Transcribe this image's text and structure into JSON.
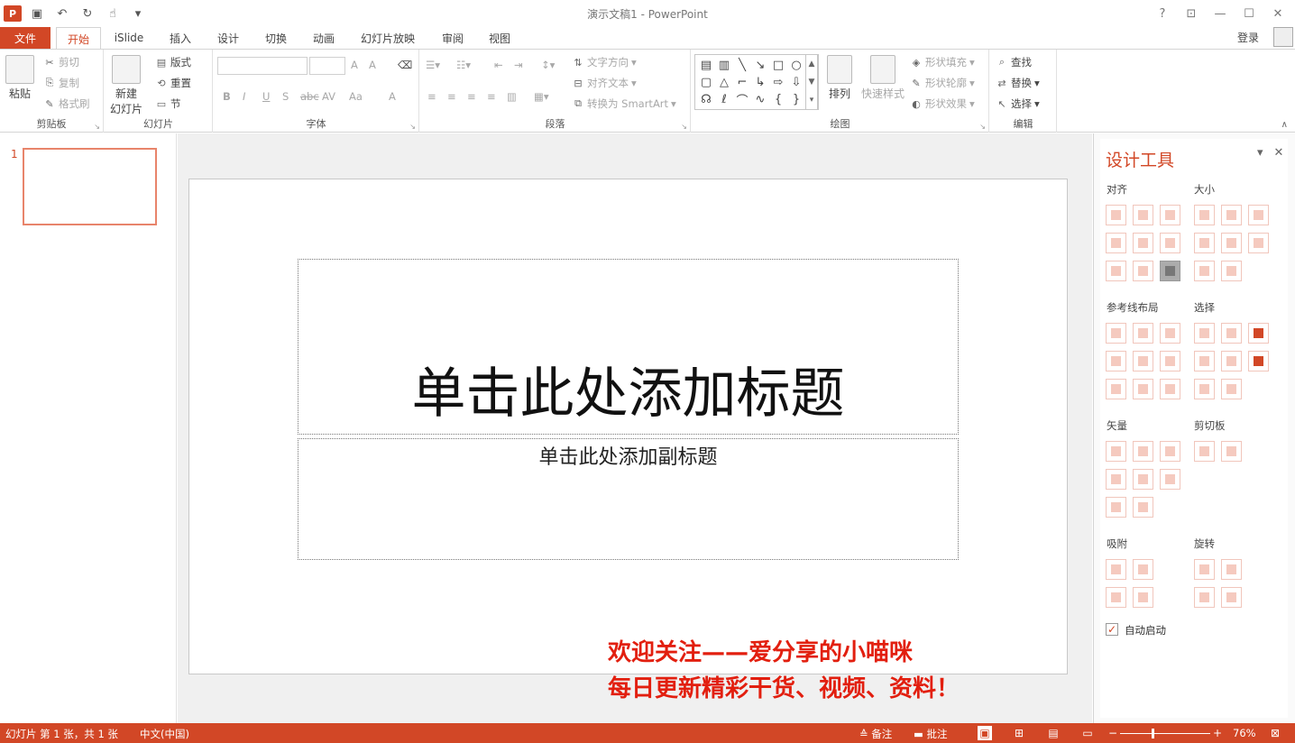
{
  "app": {
    "window_title": "演示文稿1 - PowerPoint",
    "login_label": "登录",
    "accent_color": "#d24726",
    "icon_text": "P"
  },
  "qat": {
    "icons": [
      "save-icon",
      "undo-icon",
      "redo-icon",
      "touch-mode-icon",
      "customize-qat-icon"
    ]
  },
  "window_controls": [
    "?",
    "restore-ribbon-icon",
    "minimize-icon",
    "maximize-icon",
    "close-icon"
  ],
  "tabs": {
    "file": "文件",
    "items": [
      "开始",
      "iSlide",
      "插入",
      "设计",
      "切换",
      "动画",
      "幻灯片放映",
      "审阅",
      "视图"
    ],
    "active": "开始"
  },
  "ribbon": {
    "clipboard": {
      "label": "剪贴板",
      "paste": "粘贴",
      "cut": "剪切",
      "copy": "复制",
      "format_painter": "格式刷"
    },
    "slides": {
      "label": "幻灯片",
      "new_slide_line1": "新建",
      "new_slide_line2": "幻灯片",
      "layout": "版式",
      "reset": "重置",
      "section": "节"
    },
    "font": {
      "label": "字体",
      "bold": "B",
      "italic": "I",
      "underline": "U",
      "shadow": "S",
      "strike": "abc",
      "spacing": "AV",
      "case": "Aa",
      "grow": "A",
      "shrink": "A",
      "color": "A"
    },
    "paragraph": {
      "label": "段落",
      "text_direction": "文字方向",
      "align_text": "对齐文本",
      "smartart": "转换为 SmartArt"
    },
    "drawing": {
      "label": "绘图",
      "arrange": "排列",
      "quick_styles": "快速样式",
      "shape_fill": "形状填充",
      "shape_outline": "形状轮廓",
      "shape_effects": "形状效果"
    },
    "editing": {
      "label": "编辑",
      "find": "查找",
      "replace": "替换",
      "select": "选择"
    }
  },
  "slides_pane": {
    "thumb_number": "1"
  },
  "slide": {
    "title_placeholder": "单击此处添加标题",
    "subtitle_placeholder": "单击此处添加副标题"
  },
  "overlay": {
    "line1": "欢迎关注——爱分享的小喵咪",
    "line2": "每日更新精彩干货、视频、资料！",
    "color": "#e21f0f"
  },
  "design_pane": {
    "title": "设计工具",
    "sections": {
      "align": "对齐",
      "size": "大小",
      "guide_layout": "参考线布局",
      "select": "选择",
      "vector": "矢量",
      "clipboard": "剪切板",
      "snap": "吸附",
      "rotate": "旋转"
    },
    "auto_start_label": "自动启动",
    "auto_start_checked": true
  },
  "status": {
    "slide_info": "幻灯片 第 1 张，共 1 张",
    "language": "中文(中国)",
    "notes": "备注",
    "comments": "批注",
    "zoom": "76%"
  }
}
